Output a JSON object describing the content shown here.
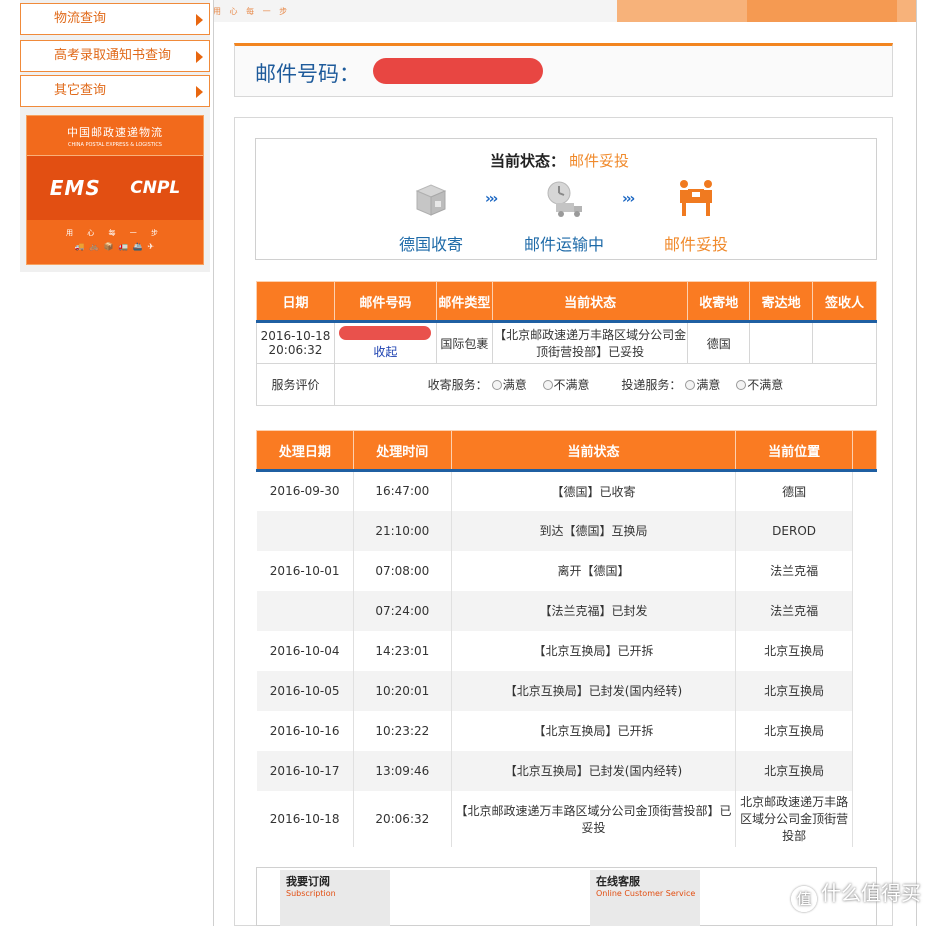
{
  "sidebar": {
    "items": [
      {
        "label": "物流查询"
      },
      {
        "label": "高考录取通知书查询"
      },
      {
        "label": "其它查询"
      }
    ],
    "banner": {
      "line1": "中国邮政速递物流",
      "line2": "CHINA POSTAL EXPRESS & LOGISTICS",
      "logo_ems": "EMS",
      "logo_cnpl": "CNPL",
      "slogan": "用 心 每 一 步"
    }
  },
  "top_strip": "用 心 每 一 步",
  "header": {
    "label": "邮件号码："
  },
  "progress": {
    "current_label": "当前状态：",
    "current_value": "邮件妥投",
    "steps": [
      {
        "label": "德国收寄",
        "icon": "package-icon",
        "state": "done"
      },
      {
        "label": "邮件运输中",
        "icon": "truck-clock-icon",
        "state": "done"
      },
      {
        "label": "邮件妥投",
        "icon": "delivery-person-icon",
        "state": "active"
      }
    ]
  },
  "summary": {
    "headers": [
      "日期",
      "邮件号码",
      "邮件类型",
      "当前状态",
      "收寄地",
      "寄达地",
      "签收人"
    ],
    "row": {
      "date": "2016-10-18 20:06:32",
      "collapse_link": "收起",
      "type": "国际包裹",
      "status": "【北京邮政速递万丰路区域分公司金顶街营投部】已妥投",
      "origin": "德国",
      "dest": "",
      "signer": ""
    },
    "evaluation": {
      "label": "服务评价",
      "collect_label": "收寄服务：",
      "deliver_label": "投递服务：",
      "satisfied": "满意",
      "unsatisfied": "不满意"
    }
  },
  "history": {
    "headers": [
      "处理日期",
      "处理时间",
      "当前状态",
      "当前位置"
    ],
    "rows": [
      {
        "date": "2016-09-30",
        "time": "16:47:00",
        "status": "【德国】已收寄",
        "location": "德国"
      },
      {
        "date": "",
        "time": "21:10:00",
        "status": "到达【德国】互换局",
        "location": "DEROD"
      },
      {
        "date": "2016-10-01",
        "time": "07:08:00",
        "status": "离开【德国】",
        "location": "法兰克福"
      },
      {
        "date": "",
        "time": "07:24:00",
        "status": "【法兰克福】已封发",
        "location": "法兰克福"
      },
      {
        "date": "2016-10-04",
        "time": "14:23:01",
        "status": "【北京互换局】已开拆",
        "location": "北京互换局"
      },
      {
        "date": "2016-10-05",
        "time": "10:20:01",
        "status": "【北京互换局】已封发(国内经转)",
        "location": "北京互换局"
      },
      {
        "date": "2016-10-16",
        "time": "10:23:22",
        "status": "【北京互换局】已开拆",
        "location": "北京互换局"
      },
      {
        "date": "2016-10-17",
        "time": "13:09:46",
        "status": "【北京互换局】已封发(国内经转)",
        "location": "北京互换局"
      },
      {
        "date": "2016-10-18",
        "time": "20:06:32",
        "status": "【北京邮政速递万丰路区域分公司金顶街营投部】已妥投",
        "location": "北京邮政速递万丰路区域分公司金顶街营投部"
      }
    ]
  },
  "bottom": {
    "subscribe_title": "我要订阅",
    "subscribe_sub": "Subscription",
    "cs_title": "在线客服",
    "cs_sub": "Online Customer Service"
  },
  "watermark": {
    "icon_char": "值",
    "text": "什么值得买"
  },
  "colors": {
    "accent_orange": "#fa7b22",
    "link_blue": "#1e5b9b",
    "status_orange": "#f08a2c",
    "header_underline": "#1f5fa2"
  }
}
